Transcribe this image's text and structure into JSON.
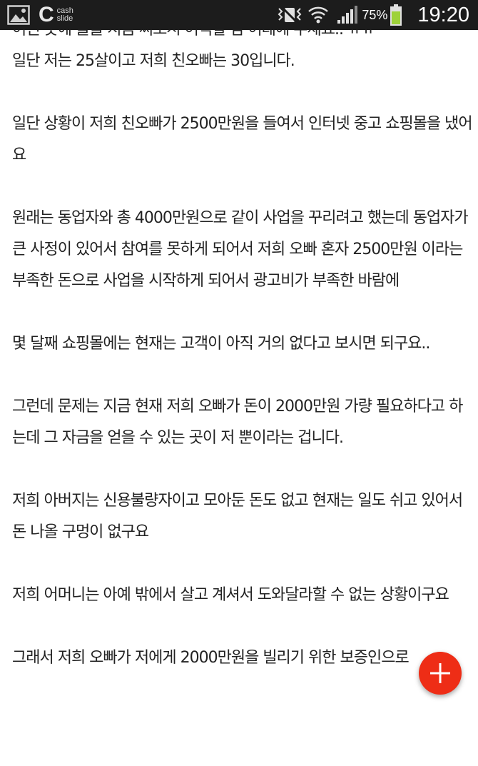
{
  "status_bar": {
    "notification_icons": [
      "gallery-icon",
      "cash-slide-icon"
    ],
    "cash_slide_logo": {
      "letter": "C",
      "line1": "cash",
      "line2": "slide"
    },
    "system_icons": [
      "mute-vibrate-icon",
      "wifi-icon",
      "signal-icon"
    ],
    "battery_percent": "75%",
    "battery_color": "#9ed23a",
    "time": "19:20"
  },
  "article": {
    "paragraphs": [
      "어떤 곳에 물을 지금 써보시 어떡할 땀 어레에 주세요.. ㅠㅠ",
      "일단 저는 25살이고 저희 친오빠는 30입니다.",
      "일단 상황이 저희 친오빠가 2500만원을 들여서 인터넷 중고 쇼핑몰을 냈어요",
      "원래는 동업자와 총 4000만원으로 같이 사업을 꾸리려고 했는데 동업자가 큰 사정이 있어서 참여를 못하게 되어서 저희 오빠 혼자 2500만원 이라는 부족한 돈으로 사업을 시작하게 되어서 광고비가 부족한 바람에",
      "몇 달째 쇼핑몰에는 현재는 고객이 아직 거의 없다고 보시면 되구요..",
      "그런데 문제는 지금 현재 저희 오빠가 돈이 2000만원 가량 필요하다고 하는데 그 자금을 얻을 수 있는 곳이 저 뿐이라는 겁니다.",
      "저희 아버지는 신용불량자이고 모아둔 돈도 없고 현재는 일도 쉬고 있어서 돈 나올 구멍이 없구요",
      "저희 어머니는 아예 밖에서 살고 계셔서 도와달라할 수 없는 상황이구요",
      "그래서 저희 오빠가 저에게 2000만원을 빌리기 위한 보증인으로"
    ]
  },
  "fab": {
    "icon": "plus-icon",
    "color": "#ee2d16"
  }
}
